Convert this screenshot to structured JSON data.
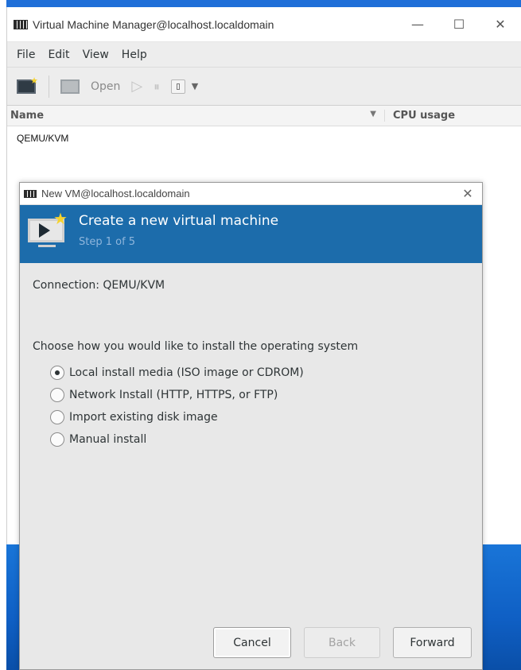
{
  "main_window": {
    "title": "Virtual Machine Manager@localhost.localdomain",
    "controls": {
      "minimize": "—",
      "maximize": "☐",
      "close": "✕"
    },
    "menu": [
      "File",
      "Edit",
      "View",
      "Help"
    ],
    "toolbar": {
      "open_label": "Open"
    },
    "list_columns": {
      "name": "Name",
      "cpu": "CPU usage"
    },
    "connections": [
      "QEMU/KVM"
    ]
  },
  "dialog": {
    "title": "New VM@localhost.localdomain",
    "close": "✕",
    "banner_title": "Create a new virtual machine",
    "banner_step": "Step 1 of 5",
    "connection_text": "Connection: QEMU/KVM",
    "prompt": "Choose how you would like to install the operating system",
    "options": [
      {
        "label": "Local install media (ISO image or CDROM)",
        "selected": true
      },
      {
        "label": "Network Install (HTTP, HTTPS, or FTP)",
        "selected": false
      },
      {
        "label": "Import existing disk image",
        "selected": false
      },
      {
        "label": "Manual install",
        "selected": false
      }
    ],
    "buttons": {
      "cancel": "Cancel",
      "back": "Back",
      "forward": "Forward"
    }
  },
  "colors": {
    "banner": "#1c6cab",
    "desktop_blue": "#1975d8"
  }
}
